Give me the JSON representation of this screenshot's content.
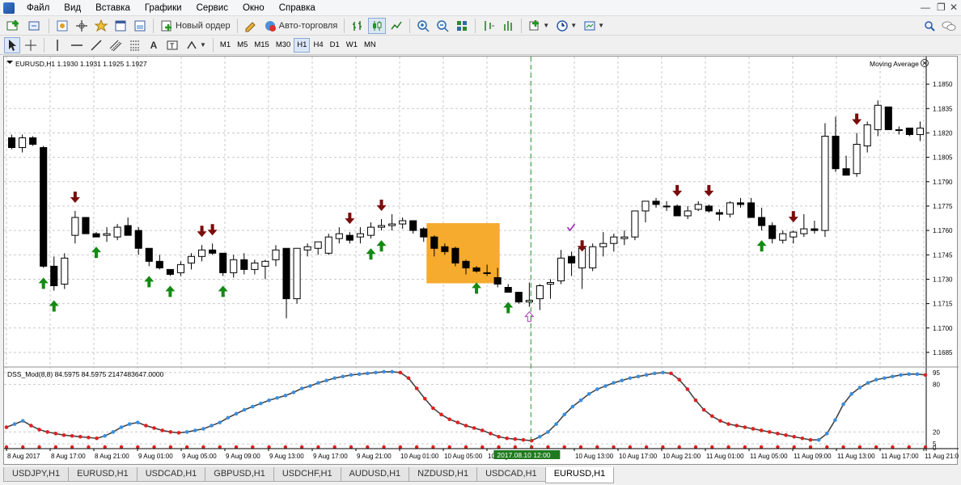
{
  "menu": [
    "Файл",
    "Вид",
    "Вставка",
    "Графики",
    "Сервис",
    "Окно",
    "Справка"
  ],
  "toolbar": {
    "new_order_label": "Новый ордер",
    "auto_trading_label": "Авто-торговля"
  },
  "timeframes": [
    "M1",
    "M5",
    "M15",
    "M30",
    "H1",
    "H4",
    "D1",
    "W1",
    "MN"
  ],
  "active_timeframe": "H1",
  "chart": {
    "header": "EURUSD,H1  1.1930 1.1931 1.1925 1.1927",
    "indicator_label": "Moving Average",
    "sub_header": "DSS_Mod(8,8) 84.5975 84.5975 2147483647.0000",
    "current_time_label": "2017.08.10 12:00"
  },
  "colors": {
    "up_arrow": "#138a13",
    "down_arrow": "#7a0c0c",
    "highlight": "#f5a623",
    "dss_line": "#444444",
    "dss_up_dot": "#3a8fe0",
    "dss_down_dot": "#e02020",
    "vline": "#2a9a2a"
  },
  "chart_data": {
    "type": "candlestick",
    "price_axis": {
      "ticks": [
        "1.1850",
        "1.1835",
        "1.1820",
        "1.1805",
        "1.1790",
        "1.1775",
        "1.1760",
        "1.1745",
        "1.1730",
        "1.1715",
        "1.1700",
        "1.1685"
      ],
      "range": [
        1.168,
        1.186
      ]
    },
    "time_labels": [
      "8 Aug 2017",
      "8 Aug 17:00",
      "8 Aug 21:00",
      "9 Aug 01:00",
      "9 Aug 05:00",
      "9 Aug 09:00",
      "9 Aug 13:00",
      "9 Aug 17:00",
      "9 Aug 21:00",
      "10 Aug 01:00",
      "10 Aug 05:00",
      "10 Aug 09:00",
      "2017.08.10 12:00",
      "10 Aug 13:00",
      "10 Aug 17:00",
      "10 Aug 21:00",
      "11 Aug 01:00",
      "11 Aug 05:00",
      "11 Aug 09:00",
      "11 Aug 13:00",
      "11 Aug 17:00",
      "11 Aug 21:00"
    ],
    "candles": [
      [
        1.1817,
        1.1819,
        1.181,
        1.1811
      ],
      [
        1.1811,
        1.1819,
        1.1808,
        1.1817
      ],
      [
        1.1817,
        1.1818,
        1.1812,
        1.1813
      ],
      [
        1.1811,
        1.1812,
        1.1737,
        1.1738
      ],
      [
        1.1738,
        1.1744,
        1.1723,
        1.1726
      ],
      [
        1.1727,
        1.1746,
        1.1724,
        1.1743
      ],
      [
        1.1757,
        1.1772,
        1.1752,
        1.1768
      ],
      [
        1.1768,
        1.1768,
        1.1759,
        1.1758
      ],
      [
        1.1758,
        1.1759,
        1.1756,
        1.1756
      ],
      [
        1.1757,
        1.1762,
        1.1753,
        1.1758
      ],
      [
        1.1756,
        1.1764,
        1.1754,
        1.1762
      ],
      [
        1.1763,
        1.1768,
        1.1757,
        1.1757
      ],
      [
        1.176,
        1.1762,
        1.1745,
        1.1749
      ],
      [
        1.1749,
        1.1749,
        1.1738,
        1.1741
      ],
      [
        1.1741,
        1.1745,
        1.1736,
        1.1737
      ],
      [
        1.1736,
        1.1736,
        1.1732,
        1.1733
      ],
      [
        1.1734,
        1.1741,
        1.1732,
        1.1739
      ],
      [
        1.174,
        1.1746,
        1.1736,
        1.1744
      ],
      [
        1.1744,
        1.1751,
        1.1741,
        1.1748
      ],
      [
        1.1748,
        1.1752,
        1.1745,
        1.1746
      ],
      [
        1.1746,
        1.1746,
        1.1732,
        1.1734
      ],
      [
        1.1734,
        1.1745,
        1.1731,
        1.1742
      ],
      [
        1.1742,
        1.1746,
        1.1733,
        1.1736
      ],
      [
        1.1736,
        1.1742,
        1.1733,
        1.174
      ],
      [
        1.1738,
        1.1742,
        1.173,
        1.1741
      ],
      [
        1.1742,
        1.1751,
        1.1738,
        1.1748
      ],
      [
        1.1749,
        1.1749,
        1.1706,
        1.1718
      ],
      [
        1.1718,
        1.1748,
        1.1715,
        1.1749
      ],
      [
        1.1748,
        1.1752,
        1.1744,
        1.175
      ],
      [
        1.1749,
        1.1751,
        1.1745,
        1.1753
      ],
      [
        1.1746,
        1.1758,
        1.1745,
        1.1756
      ],
      [
        1.1755,
        1.1762,
        1.1752,
        1.1758
      ],
      [
        1.1757,
        1.1759,
        1.1752,
        1.1754
      ],
      [
        1.1756,
        1.1762,
        1.1752,
        1.1758
      ],
      [
        1.1757,
        1.1765,
        1.1755,
        1.1762
      ],
      [
        1.1762,
        1.1767,
        1.176,
        1.1763
      ],
      [
        1.1763,
        1.177,
        1.176,
        1.1764
      ],
      [
        1.1764,
        1.1768,
        1.1761,
        1.1766
      ],
      [
        1.1766,
        1.1766,
        1.1758,
        1.176
      ],
      [
        1.1761,
        1.1762,
        1.1753,
        1.1756
      ],
      [
        1.1756,
        1.1757,
        1.1744,
        1.1749
      ],
      [
        1.175,
        1.1752,
        1.1745,
        1.1747
      ],
      [
        1.1749,
        1.175,
        1.1738,
        1.174
      ],
      [
        1.1741,
        1.1742,
        1.1733,
        1.1737
      ],
      [
        1.1737,
        1.1738,
        1.1734,
        1.1735
      ],
      [
        1.1734,
        1.1739,
        1.1732,
        1.1734
      ],
      [
        1.1731,
        1.1737,
        1.1725,
        1.1727
      ],
      [
        1.1725,
        1.1727,
        1.1722,
        1.1722
      ],
      [
        1.1722,
        1.1722,
        1.1715,
        1.1716
      ],
      [
        1.1716,
        1.1728,
        1.1713,
        1.1717
      ],
      [
        1.1718,
        1.1727,
        1.1711,
        1.1726
      ],
      [
        1.1727,
        1.173,
        1.1718,
        1.1728
      ],
      [
        1.1729,
        1.1748,
        1.1727,
        1.1743
      ],
      [
        1.1744,
        1.1747,
        1.1732,
        1.174
      ],
      [
        1.1737,
        1.1742,
        1.1724,
        1.1749
      ],
      [
        1.1737,
        1.1752,
        1.1735,
        1.175
      ],
      [
        1.175,
        1.1759,
        1.1744,
        1.1752
      ],
      [
        1.1752,
        1.1758,
        1.1747,
        1.1756
      ],
      [
        1.1755,
        1.176,
        1.1751,
        1.1756
      ],
      [
        1.1756,
        1.1767,
        1.1754,
        1.1772
      ],
      [
        1.1772,
        1.1778,
        1.1765,
        1.1778
      ],
      [
        1.1778,
        1.178,
        1.1774,
        1.1776
      ],
      [
        1.1775,
        1.1778,
        1.1772,
        1.1775
      ],
      [
        1.1775,
        1.1776,
        1.1769,
        1.1769
      ],
      [
        1.1769,
        1.1775,
        1.1767,
        1.1772
      ],
      [
        1.1773,
        1.1778,
        1.1772,
        1.1776
      ],
      [
        1.1775,
        1.1776,
        1.1771,
        1.1772
      ],
      [
        1.1771,
        1.1773,
        1.1766,
        1.177
      ],
      [
        1.177,
        1.1778,
        1.1768,
        1.1777
      ],
      [
        1.1777,
        1.178,
        1.1774,
        1.1776
      ],
      [
        1.1777,
        1.178,
        1.177,
        1.1768
      ],
      [
        1.1768,
        1.1774,
        1.176,
        1.1763
      ],
      [
        1.1763,
        1.1765,
        1.1752,
        1.1755
      ],
      [
        1.1754,
        1.176,
        1.1752,
        1.1758
      ],
      [
        1.1756,
        1.176,
        1.1752,
        1.1759
      ],
      [
        1.1758,
        1.177,
        1.1756,
        1.1761
      ],
      [
        1.1761,
        1.1766,
        1.1758,
        1.176
      ],
      [
        1.176,
        1.1826,
        1.1756,
        1.1818
      ],
      [
        1.1818,
        1.183,
        1.1796,
        1.1798
      ],
      [
        1.1798,
        1.1806,
        1.1794,
        1.1794
      ],
      [
        1.1795,
        1.182,
        1.1793,
        1.1813
      ],
      [
        1.1812,
        1.1827,
        1.1808,
        1.1825
      ],
      [
        1.1822,
        1.184,
        1.1818,
        1.1837
      ],
      [
        1.1836,
        1.1836,
        1.1822,
        1.1822
      ],
      [
        1.1822,
        1.1824,
        1.1819,
        1.1822
      ],
      [
        1.1823,
        1.1823,
        1.1818,
        1.1819
      ],
      [
        1.1819,
        1.1827,
        1.1815,
        1.1823
      ]
    ],
    "buy_signals": [
      3,
      4,
      8,
      13,
      15,
      20,
      34,
      35,
      44,
      47,
      71
    ],
    "sell_signals": [
      6,
      18,
      19,
      32,
      35,
      54,
      63,
      66,
      74,
      80
    ],
    "dss": {
      "axis_ticks": [
        "95",
        "80",
        "20",
        "5",
        "0"
      ],
      "values": [
        26,
        30,
        34,
        28,
        23,
        20,
        18,
        16,
        15,
        14,
        13,
        12,
        15,
        20,
        26,
        30,
        32,
        28,
        25,
        22,
        20,
        19,
        20,
        22,
        24,
        28,
        32,
        38,
        43,
        48,
        52,
        56,
        60,
        63,
        66,
        70,
        75,
        78,
        82,
        85,
        88,
        90,
        92,
        93,
        94,
        95,
        96,
        96,
        95,
        88,
        75,
        62,
        50,
        42,
        36,
        32,
        28,
        25,
        22,
        18,
        14,
        12,
        11,
        10,
        9,
        14,
        20,
        30,
        42,
        52,
        60,
        68,
        74,
        78,
        82,
        85,
        88,
        90,
        92,
        94,
        95,
        94,
        86,
        74,
        60,
        48,
        40,
        34,
        30,
        28,
        26,
        24,
        22,
        20,
        18,
        16,
        14,
        12,
        10,
        10,
        18,
        35,
        55,
        68,
        76,
        82,
        86,
        88,
        90,
        92,
        93,
        93,
        92
      ],
      "levels": [
        95,
        80,
        20,
        5
      ]
    }
  }
}
